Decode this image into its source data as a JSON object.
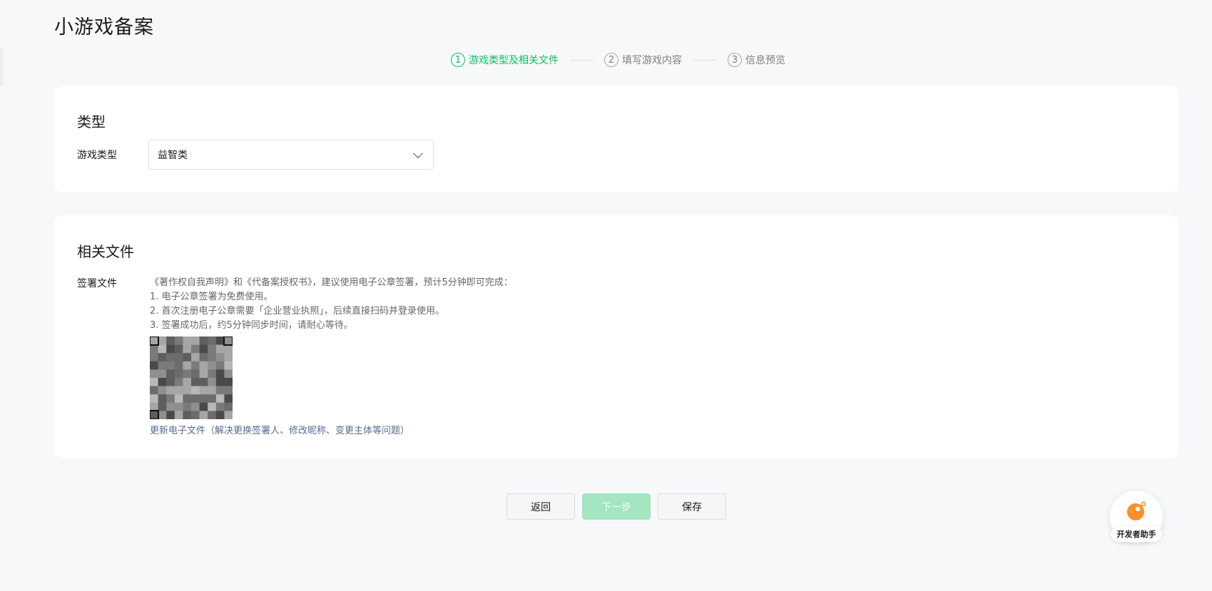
{
  "page": {
    "title": "小游戏备案"
  },
  "steps": [
    {
      "num": "1",
      "label": "游戏类型及相关文件",
      "active": true
    },
    {
      "num": "2",
      "label": "填写游戏内容",
      "active": false
    },
    {
      "num": "3",
      "label": "信息预览",
      "active": false
    }
  ],
  "type_section": {
    "heading": "类型",
    "field_label": "游戏类型",
    "select_value": "益智类"
  },
  "files_section": {
    "heading": "相关文件",
    "field_label": "签署文件",
    "desc_lines": [
      "《著作权自我声明》和《代备案授权书》，建议使用电子公章签署，预计5分钟即可完成：",
      "1. 电子公章签署为免费使用。",
      "2. 首次注册电子公章需要「企业营业执照」，后续直接扫码并登录使用。",
      "3. 签署成功后，约5分钟同步时间，请耐心等待。"
    ],
    "qr_icon": "qr-code-icon",
    "update_link": "更新电子文件（解决更换签署人、修改昵称、变更主体等问题）"
  },
  "actions": {
    "back_label": "返回",
    "next_label": "下一步",
    "save_label": "保存"
  },
  "assistant": {
    "icon": "developer-assistant-icon",
    "label": "开发者助手"
  },
  "colors": {
    "accent": "#07c160",
    "next_disabled": "#a3e6c1",
    "link": "#576b95",
    "background": "#f7f8fa",
    "assistant_orange": "#fa8f2c"
  }
}
